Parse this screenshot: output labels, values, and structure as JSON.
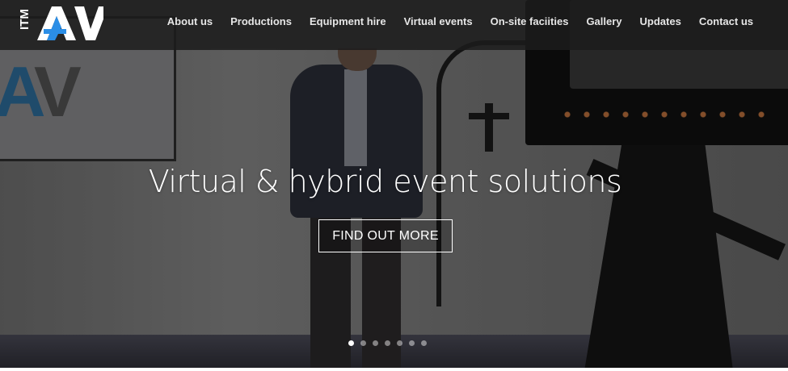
{
  "brand": {
    "logo_text": "ITM AV",
    "logo_prefix": "ITM",
    "logo_mark": "AV",
    "accent_color": "#2b8ee6",
    "white": "#ffffff"
  },
  "nav": {
    "items": [
      {
        "label": "About us"
      },
      {
        "label": "Productions"
      },
      {
        "label": "Equipment hire"
      },
      {
        "label": "Virtual events"
      },
      {
        "label": "On-site faciities"
      },
      {
        "label": "Gallery"
      },
      {
        "label": "Updates"
      },
      {
        "label": "Contact us"
      }
    ]
  },
  "hero": {
    "headline": "Virtual & hybrid event solutions",
    "cta_label": "FIND OUT MORE",
    "slide_count": 7,
    "active_slide": 1
  }
}
